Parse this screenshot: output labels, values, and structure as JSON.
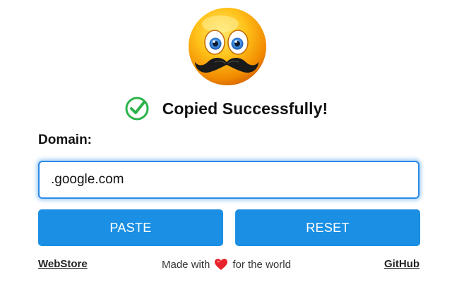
{
  "status": {
    "message": "Copied Successfully!",
    "icon": "check-circle-icon",
    "icon_color": "#2cb34a"
  },
  "mascot": {
    "icon": "mustache-smiley-icon"
  },
  "form": {
    "domain_label": "Domain:",
    "domain_value": ".google.com"
  },
  "buttons": {
    "paste_label": "PASTE",
    "reset_label": "RESET",
    "color": "#1a8fe3"
  },
  "footer": {
    "webstore_label": "WebStore",
    "made_with_prefix": "Made with",
    "made_with_suffix": "for the world",
    "heart_icon": "heart-icon",
    "github_label": "GitHub"
  }
}
